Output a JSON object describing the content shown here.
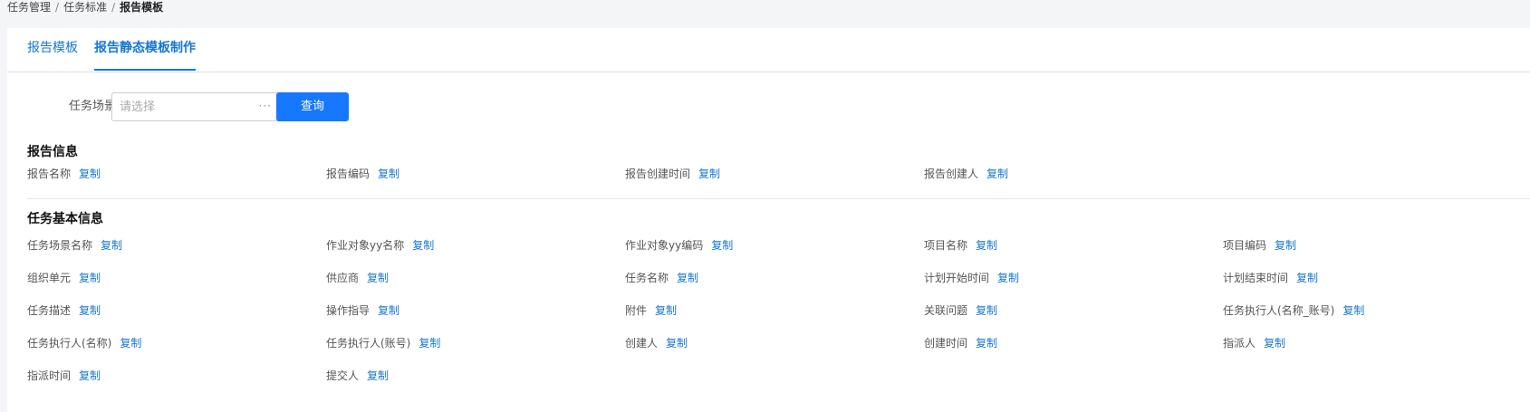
{
  "breadcrumb": {
    "items": [
      "任务管理",
      "任务标准"
    ],
    "separator": "/",
    "current": "报告模板"
  },
  "tabs": [
    {
      "label": "报告模板",
      "active": false
    },
    {
      "label": "报告静态模板制作",
      "active": true
    }
  ],
  "query": {
    "label": "任务场景",
    "placeholder": "请选择",
    "more_icon": "···",
    "button_label": "查询"
  },
  "copy_label": "复制",
  "sections": [
    {
      "title": "报告信息",
      "fields": [
        "报告名称",
        "报告编码",
        "报告创建时间",
        "报告创建人"
      ]
    },
    {
      "title": "任务基本信息",
      "fields": [
        "任务场景名称",
        "作业对象yy名称",
        "作业对象yy编码",
        "项目名称",
        "项目编码",
        "组织单元",
        "供应商",
        "任务名称",
        "计划开始时间",
        "计划结束时间",
        "任务描述",
        "操作指导",
        "附件",
        "关联问题",
        "任务执行人(名称_账号)",
        "任务执行人(名称)",
        "任务执行人(账号)",
        "创建人",
        "创建时间",
        "指派人",
        "指派时间",
        "提交人"
      ]
    }
  ],
  "colors": {
    "accent": "#1677d2",
    "button": "#1677ff",
    "background": "#f4f5f7"
  }
}
